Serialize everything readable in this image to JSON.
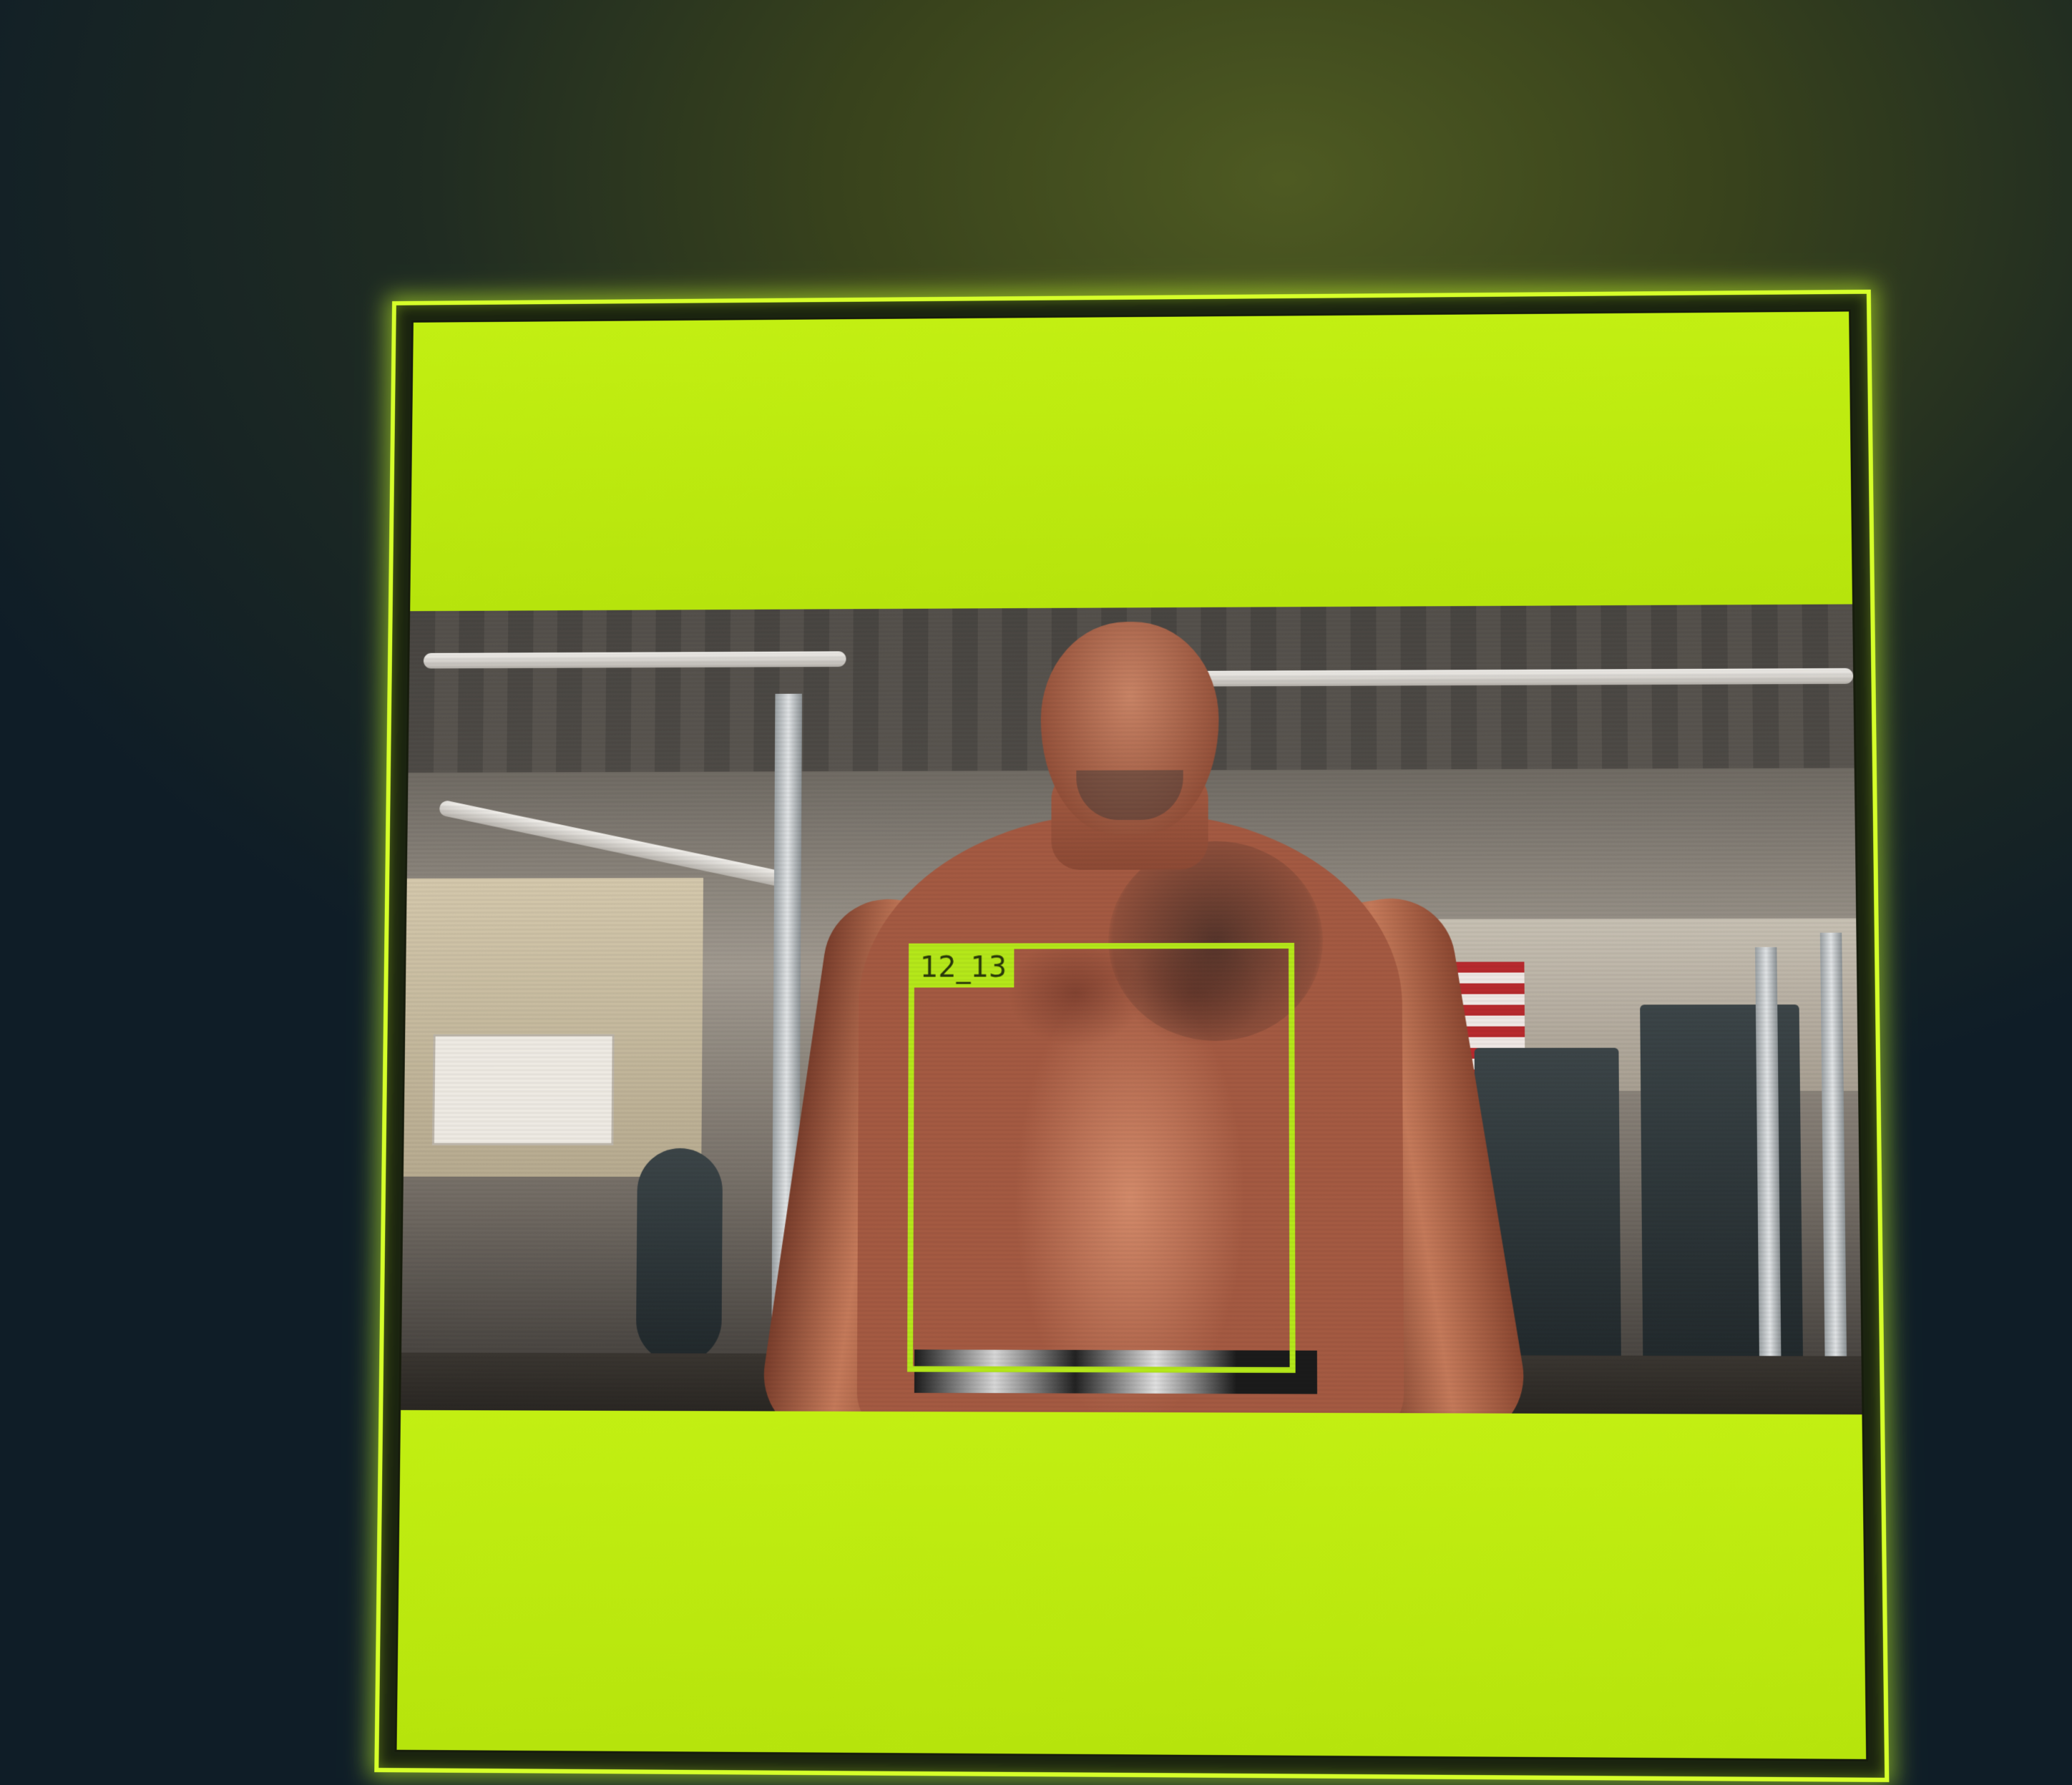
{
  "detection": {
    "label": "12_13",
    "box_color": "#b5e81a"
  },
  "colors": {
    "pad_color": "#bfee10",
    "frame_glow": "#d6ff2a"
  },
  "icons": {
    "flag": "american-flag-decor"
  }
}
